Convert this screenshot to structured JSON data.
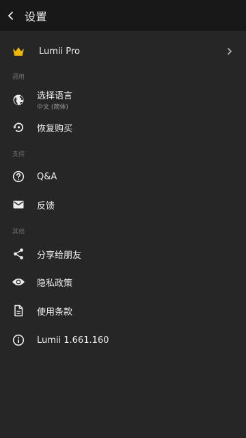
{
  "header": {
    "title": "设置"
  },
  "pro": {
    "label": "Lumii Pro"
  },
  "sections": {
    "general": "通用",
    "support": "支持",
    "other": "其他"
  },
  "items": {
    "language": {
      "label": "选择语言",
      "value": "中文 (简体)"
    },
    "restore": {
      "label": "恢复购买"
    },
    "qa": {
      "label": "Q&A"
    },
    "feedback": {
      "label": "反馈"
    },
    "share": {
      "label": "分享给朋友"
    },
    "privacy": {
      "label": "隐私政策"
    },
    "terms": {
      "label": "使用条款"
    },
    "version": {
      "label": "Lumii 1.661.160"
    }
  },
  "colors": {
    "background": "#262626",
    "appbar": "#181818",
    "crown": "#f0b90b",
    "section_text": "#6d6d6d"
  }
}
